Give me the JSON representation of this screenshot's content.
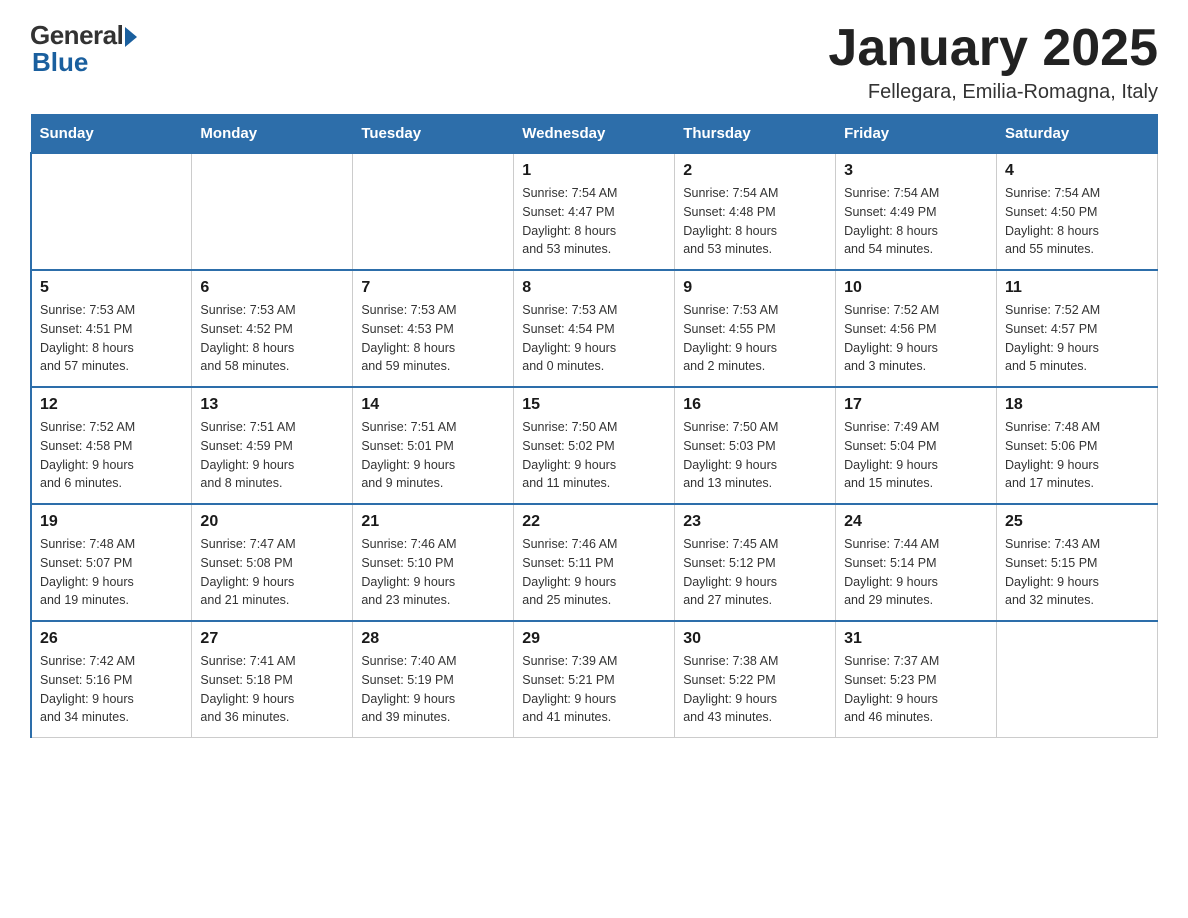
{
  "logo": {
    "general_text": "General",
    "blue_text": "Blue"
  },
  "title": "January 2025",
  "subtitle": "Fellegara, Emilia-Romagna, Italy",
  "days_of_week": [
    "Sunday",
    "Monday",
    "Tuesday",
    "Wednesday",
    "Thursday",
    "Friday",
    "Saturday"
  ],
  "weeks": [
    [
      {
        "day": "",
        "info": ""
      },
      {
        "day": "",
        "info": ""
      },
      {
        "day": "",
        "info": ""
      },
      {
        "day": "1",
        "info": "Sunrise: 7:54 AM\nSunset: 4:47 PM\nDaylight: 8 hours\nand 53 minutes."
      },
      {
        "day": "2",
        "info": "Sunrise: 7:54 AM\nSunset: 4:48 PM\nDaylight: 8 hours\nand 53 minutes."
      },
      {
        "day": "3",
        "info": "Sunrise: 7:54 AM\nSunset: 4:49 PM\nDaylight: 8 hours\nand 54 minutes."
      },
      {
        "day": "4",
        "info": "Sunrise: 7:54 AM\nSunset: 4:50 PM\nDaylight: 8 hours\nand 55 minutes."
      }
    ],
    [
      {
        "day": "5",
        "info": "Sunrise: 7:53 AM\nSunset: 4:51 PM\nDaylight: 8 hours\nand 57 minutes."
      },
      {
        "day": "6",
        "info": "Sunrise: 7:53 AM\nSunset: 4:52 PM\nDaylight: 8 hours\nand 58 minutes."
      },
      {
        "day": "7",
        "info": "Sunrise: 7:53 AM\nSunset: 4:53 PM\nDaylight: 8 hours\nand 59 minutes."
      },
      {
        "day": "8",
        "info": "Sunrise: 7:53 AM\nSunset: 4:54 PM\nDaylight: 9 hours\nand 0 minutes."
      },
      {
        "day": "9",
        "info": "Sunrise: 7:53 AM\nSunset: 4:55 PM\nDaylight: 9 hours\nand 2 minutes."
      },
      {
        "day": "10",
        "info": "Sunrise: 7:52 AM\nSunset: 4:56 PM\nDaylight: 9 hours\nand 3 minutes."
      },
      {
        "day": "11",
        "info": "Sunrise: 7:52 AM\nSunset: 4:57 PM\nDaylight: 9 hours\nand 5 minutes."
      }
    ],
    [
      {
        "day": "12",
        "info": "Sunrise: 7:52 AM\nSunset: 4:58 PM\nDaylight: 9 hours\nand 6 minutes."
      },
      {
        "day": "13",
        "info": "Sunrise: 7:51 AM\nSunset: 4:59 PM\nDaylight: 9 hours\nand 8 minutes."
      },
      {
        "day": "14",
        "info": "Sunrise: 7:51 AM\nSunset: 5:01 PM\nDaylight: 9 hours\nand 9 minutes."
      },
      {
        "day": "15",
        "info": "Sunrise: 7:50 AM\nSunset: 5:02 PM\nDaylight: 9 hours\nand 11 minutes."
      },
      {
        "day": "16",
        "info": "Sunrise: 7:50 AM\nSunset: 5:03 PM\nDaylight: 9 hours\nand 13 minutes."
      },
      {
        "day": "17",
        "info": "Sunrise: 7:49 AM\nSunset: 5:04 PM\nDaylight: 9 hours\nand 15 minutes."
      },
      {
        "day": "18",
        "info": "Sunrise: 7:48 AM\nSunset: 5:06 PM\nDaylight: 9 hours\nand 17 minutes."
      }
    ],
    [
      {
        "day": "19",
        "info": "Sunrise: 7:48 AM\nSunset: 5:07 PM\nDaylight: 9 hours\nand 19 minutes."
      },
      {
        "day": "20",
        "info": "Sunrise: 7:47 AM\nSunset: 5:08 PM\nDaylight: 9 hours\nand 21 minutes."
      },
      {
        "day": "21",
        "info": "Sunrise: 7:46 AM\nSunset: 5:10 PM\nDaylight: 9 hours\nand 23 minutes."
      },
      {
        "day": "22",
        "info": "Sunrise: 7:46 AM\nSunset: 5:11 PM\nDaylight: 9 hours\nand 25 minutes."
      },
      {
        "day": "23",
        "info": "Sunrise: 7:45 AM\nSunset: 5:12 PM\nDaylight: 9 hours\nand 27 minutes."
      },
      {
        "day": "24",
        "info": "Sunrise: 7:44 AM\nSunset: 5:14 PM\nDaylight: 9 hours\nand 29 minutes."
      },
      {
        "day": "25",
        "info": "Sunrise: 7:43 AM\nSunset: 5:15 PM\nDaylight: 9 hours\nand 32 minutes."
      }
    ],
    [
      {
        "day": "26",
        "info": "Sunrise: 7:42 AM\nSunset: 5:16 PM\nDaylight: 9 hours\nand 34 minutes."
      },
      {
        "day": "27",
        "info": "Sunrise: 7:41 AM\nSunset: 5:18 PM\nDaylight: 9 hours\nand 36 minutes."
      },
      {
        "day": "28",
        "info": "Sunrise: 7:40 AM\nSunset: 5:19 PM\nDaylight: 9 hours\nand 39 minutes."
      },
      {
        "day": "29",
        "info": "Sunrise: 7:39 AM\nSunset: 5:21 PM\nDaylight: 9 hours\nand 41 minutes."
      },
      {
        "day": "30",
        "info": "Sunrise: 7:38 AM\nSunset: 5:22 PM\nDaylight: 9 hours\nand 43 minutes."
      },
      {
        "day": "31",
        "info": "Sunrise: 7:37 AM\nSunset: 5:23 PM\nDaylight: 9 hours\nand 46 minutes."
      },
      {
        "day": "",
        "info": ""
      }
    ]
  ]
}
